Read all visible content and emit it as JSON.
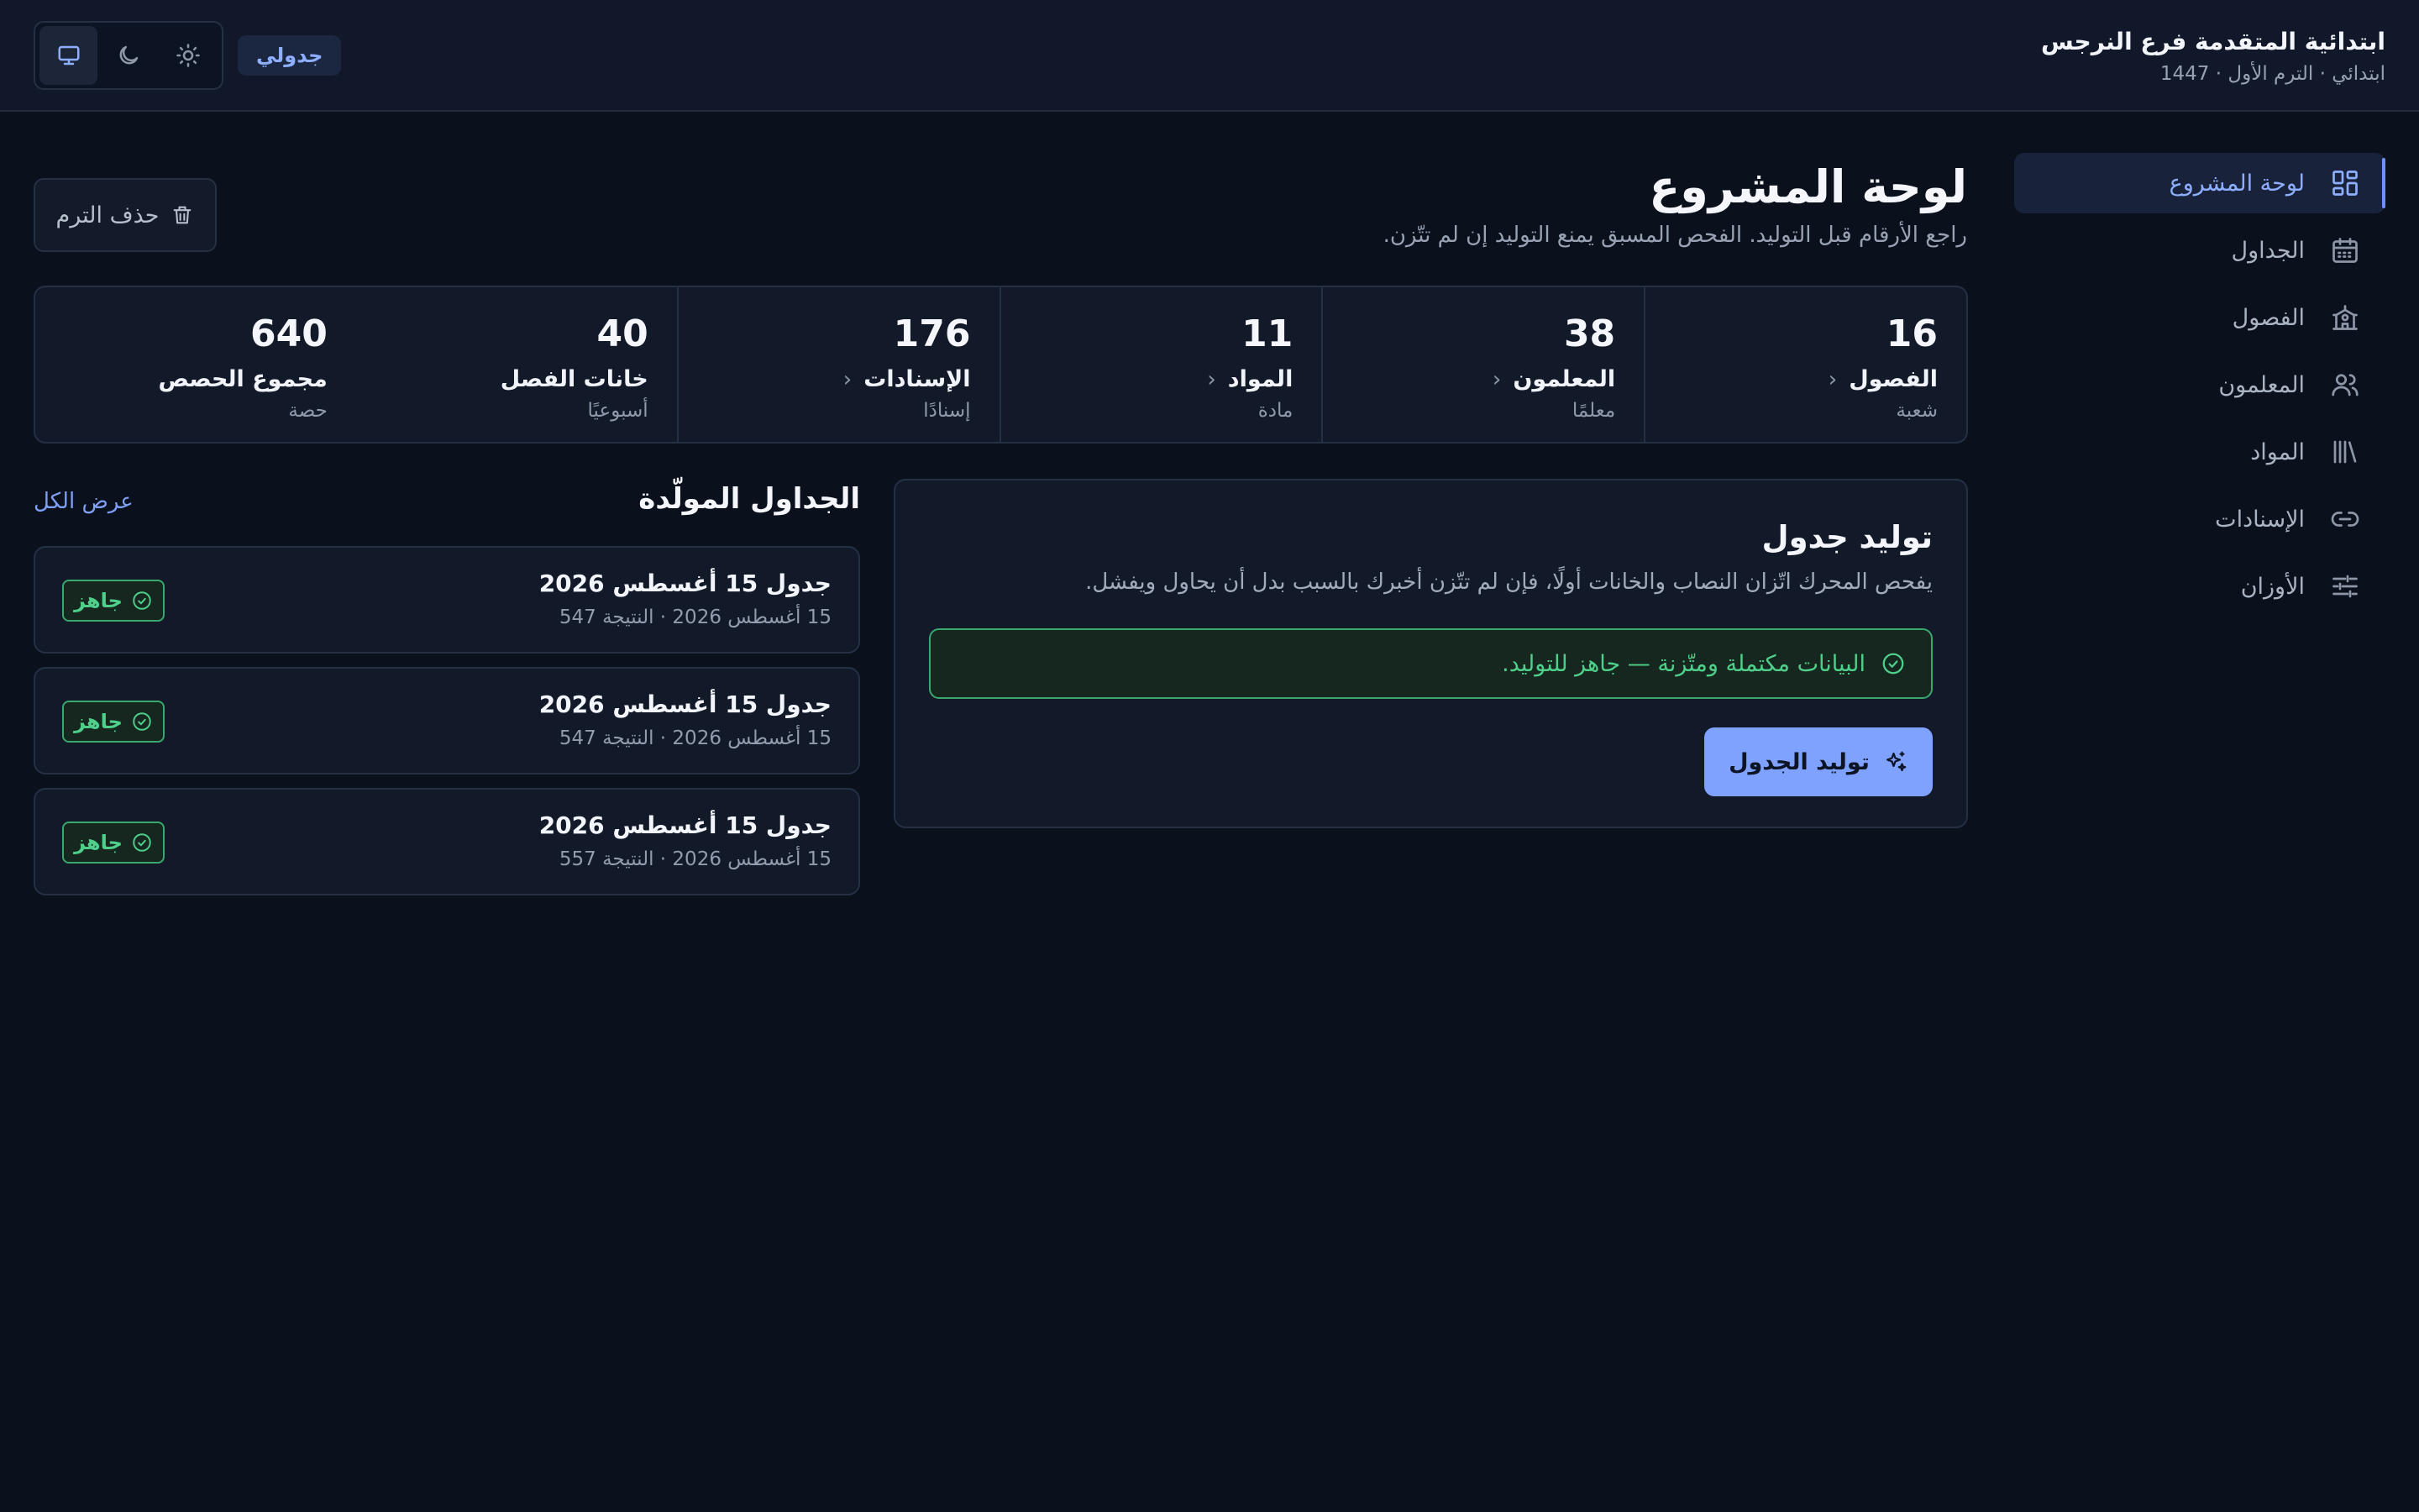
{
  "header": {
    "school_name": "ابتدائية المتقدمة فرع النرجس",
    "school_sub": "ابتدائي · الترم الأول · 1447",
    "app_badge": "جدولي",
    "theme_icons": [
      "monitor-icon",
      "moon-icon",
      "sun-icon"
    ]
  },
  "sidebar": {
    "items": [
      {
        "label": "لوحة المشروع",
        "icon": "dashboard-icon",
        "active": true
      },
      {
        "label": "الجداول",
        "icon": "calendar-icon",
        "active": false
      },
      {
        "label": "الفصول",
        "icon": "school-icon",
        "active": false
      },
      {
        "label": "المعلمون",
        "icon": "users-icon",
        "active": false
      },
      {
        "label": "المواد",
        "icon": "books-icon",
        "active": false
      },
      {
        "label": "الإسنادات",
        "icon": "link-icon",
        "active": false
      },
      {
        "label": "الأوزان",
        "icon": "sliders-icon",
        "active": false
      }
    ]
  },
  "main": {
    "title": "لوحة المشروع",
    "subtitle": "راجع الأرقام قبل التوليد. الفحص المسبق يمنع التوليد إن لم تتّزن.",
    "delete_label": "حذف الترم"
  },
  "stats": [
    {
      "value": "16",
      "label": "الفصول",
      "unit": "شعبة",
      "link": true
    },
    {
      "value": "38",
      "label": "المعلمون",
      "unit": "معلمًا",
      "link": true
    },
    {
      "value": "11",
      "label": "المواد",
      "unit": "مادة",
      "link": true
    },
    {
      "value": "176",
      "label": "الإسنادات",
      "unit": "إسنادًا",
      "link": true
    },
    {
      "value": "40",
      "label": "خانات الفصل",
      "unit": "أسبوعيًا",
      "link": false
    },
    {
      "value": "640",
      "label": "مجموع الحصص",
      "unit": "حصة",
      "link": false
    }
  ],
  "generate": {
    "title": "توليد جدول",
    "description": "يفحص المحرك اتّزان النصاب والخانات أولًا، فإن لم تتّزن أخبرك بالسبب بدل أن يحاول ويفشل.",
    "ready_message": "البيانات مكتملة ومتّزنة — جاهز للتوليد.",
    "button_label": "توليد الجدول"
  },
  "schedules": {
    "title": "الجداول المولّدة",
    "view_all": "عرض الكل",
    "items": [
      {
        "title": "جدول 15 أغسطس 2026",
        "sub": "15 أغسطس 2026 · النتيجة 547",
        "status": "جاهز"
      },
      {
        "title": "جدول 15 أغسطس 2026",
        "sub": "15 أغسطس 2026 · النتيجة 547",
        "status": "جاهز"
      },
      {
        "title": "جدول 15 أغسطس 2026",
        "sub": "15 أغسطس 2026 · النتيجة 557",
        "status": "جاهز"
      }
    ]
  },
  "colors": {
    "background": "#0a101c",
    "accent": "#7fa2ff",
    "success": "#4fd08a"
  }
}
